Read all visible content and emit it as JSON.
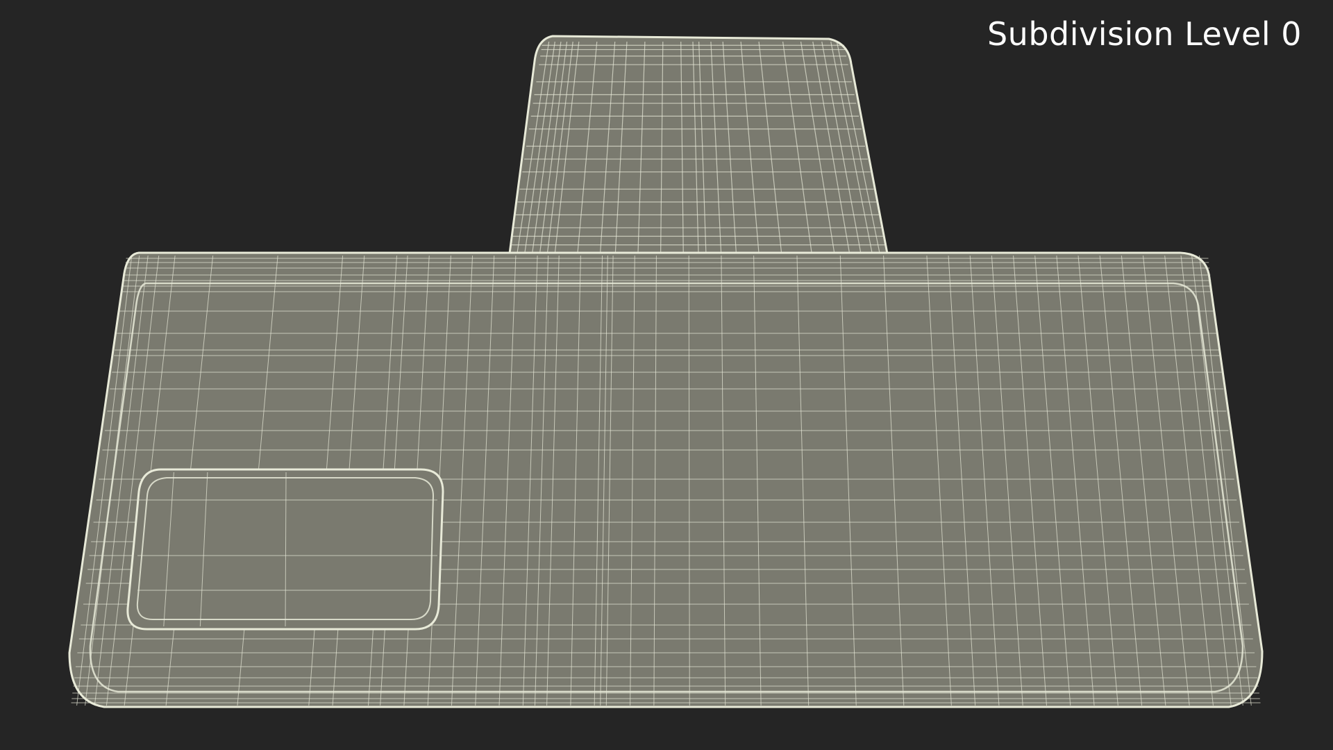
{
  "viewport": {
    "background_color": "#252525",
    "overlay_label": "Subdivision Level 0"
  },
  "model": {
    "render_mode": "wireframe",
    "surface_color": "#7a7a6f",
    "wire_color": "#e8ead8",
    "parts": [
      "rear-panel",
      "main-body",
      "camera-module"
    ]
  }
}
